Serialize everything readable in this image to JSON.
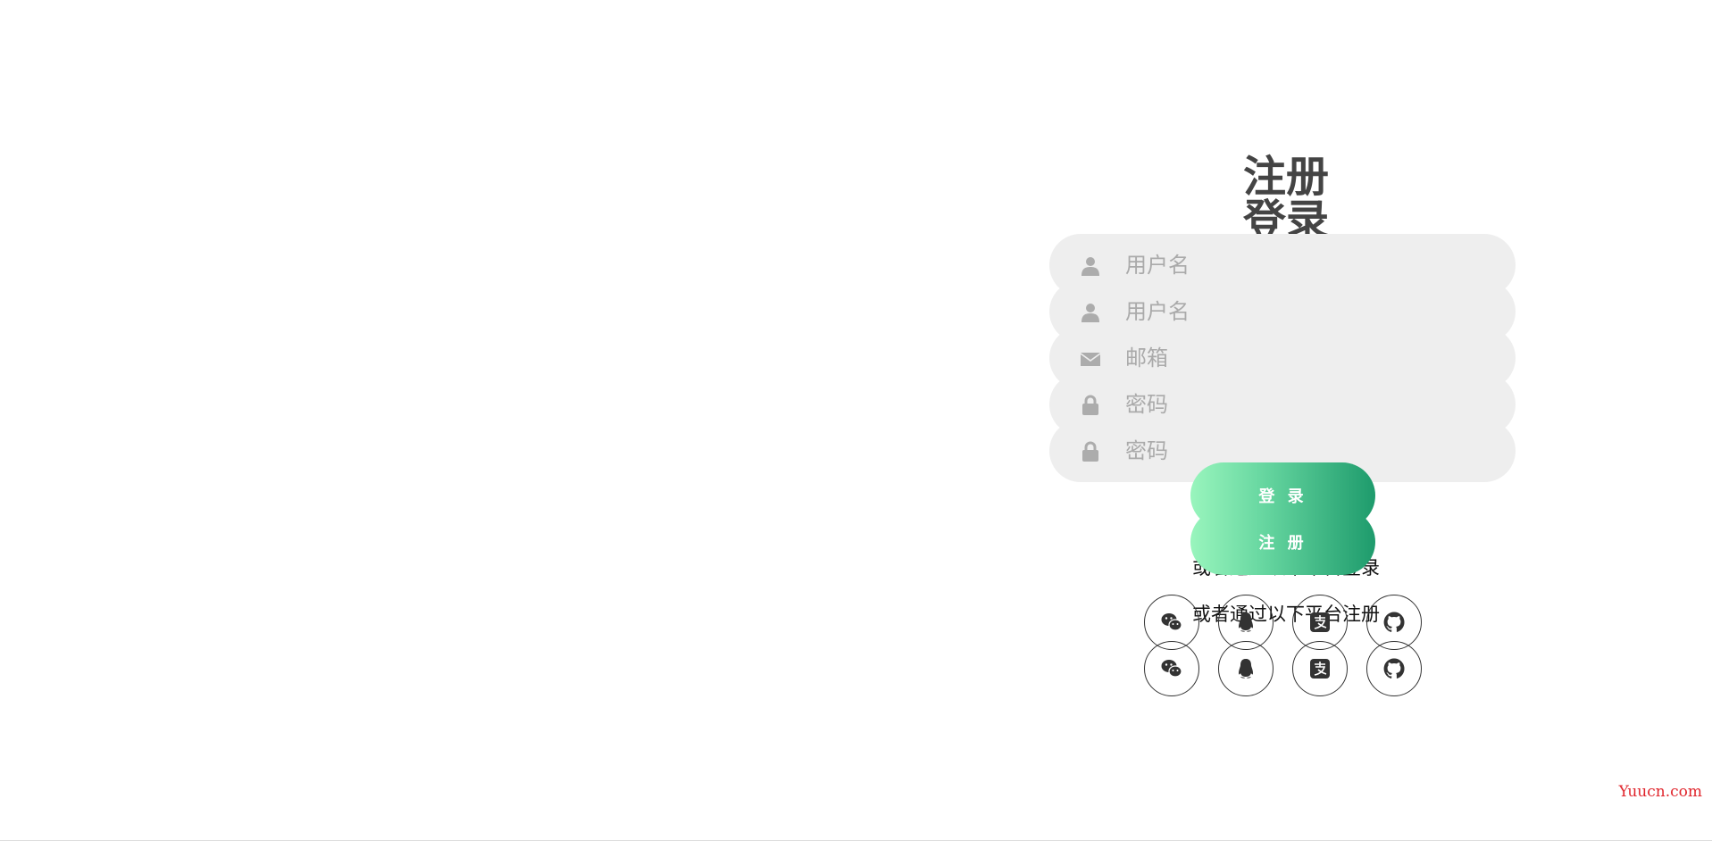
{
  "forms": {
    "register_title": "注册",
    "login_title": "登录",
    "fields": [
      {
        "placeholder": "用户名",
        "icon": "user-icon"
      },
      {
        "placeholder": "用户名",
        "icon": "user-icon"
      },
      {
        "placeholder": "邮箱",
        "icon": "envelope-icon"
      },
      {
        "placeholder": "密码",
        "icon": "lock-icon"
      },
      {
        "placeholder": "密码",
        "icon": "lock-icon"
      }
    ],
    "login_button": "登 录",
    "register_button": "注 册",
    "social_login_text": "或者通过以下平台登录",
    "social_register_text": "或者通过以下平台注册",
    "social_icons": [
      "wechat-icon",
      "qq-icon",
      "alipay-icon",
      "github-icon"
    ]
  },
  "colors": {
    "button_gradient_start": "#99f5bd",
    "button_gradient_end": "#1e9b6c",
    "input_bg": "#eeeeee",
    "placeholder": "#aaaaaa",
    "title": "#444444",
    "watermark": "#e0242b"
  },
  "watermark": "Yuucn.com"
}
